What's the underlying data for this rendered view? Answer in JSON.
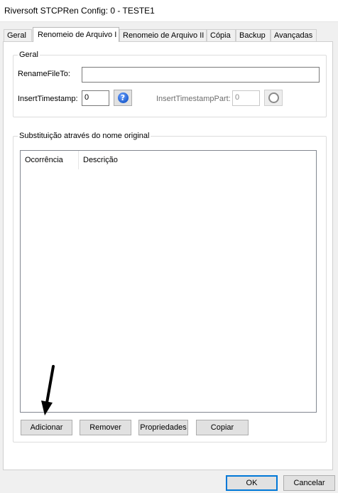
{
  "window": {
    "title": "Riversoft STCPRen Config: 0 - TESTE1"
  },
  "tabs": [
    {
      "label": "Geral"
    },
    {
      "label": "Renomeio de Arquivo I"
    },
    {
      "label": "Renomeio de Arquivo II"
    },
    {
      "label": "Cópia"
    },
    {
      "label": "Backup"
    },
    {
      "label": "Avançadas"
    }
  ],
  "active_tab": "Renomeio de Arquivo I",
  "geral": {
    "legend": "Geral",
    "rename_label": "RenameFileTo:",
    "rename_value": "",
    "timestamp_label": "InsertTimestamp:",
    "timestamp_value": "0",
    "timestamp_part_label": "InsertTimestampPart:",
    "timestamp_part_value": "0",
    "help_icon": "question-icon",
    "disabled_icon": "disabled-help-icon"
  },
  "substituicao": {
    "legend": "Substituição através do nome original",
    "columns": [
      "Ocorrência",
      "Descrição"
    ],
    "rows": [],
    "buttons": {
      "add": "Adicionar",
      "remove": "Remover",
      "props": "Propriedades",
      "copy": "Copiar"
    }
  },
  "footer": {
    "ok": "OK",
    "cancel": "Cancelar"
  },
  "colors": {
    "accent": "#0078d7",
    "help_icon": "#1f5fd0",
    "arrow": "#000000"
  }
}
